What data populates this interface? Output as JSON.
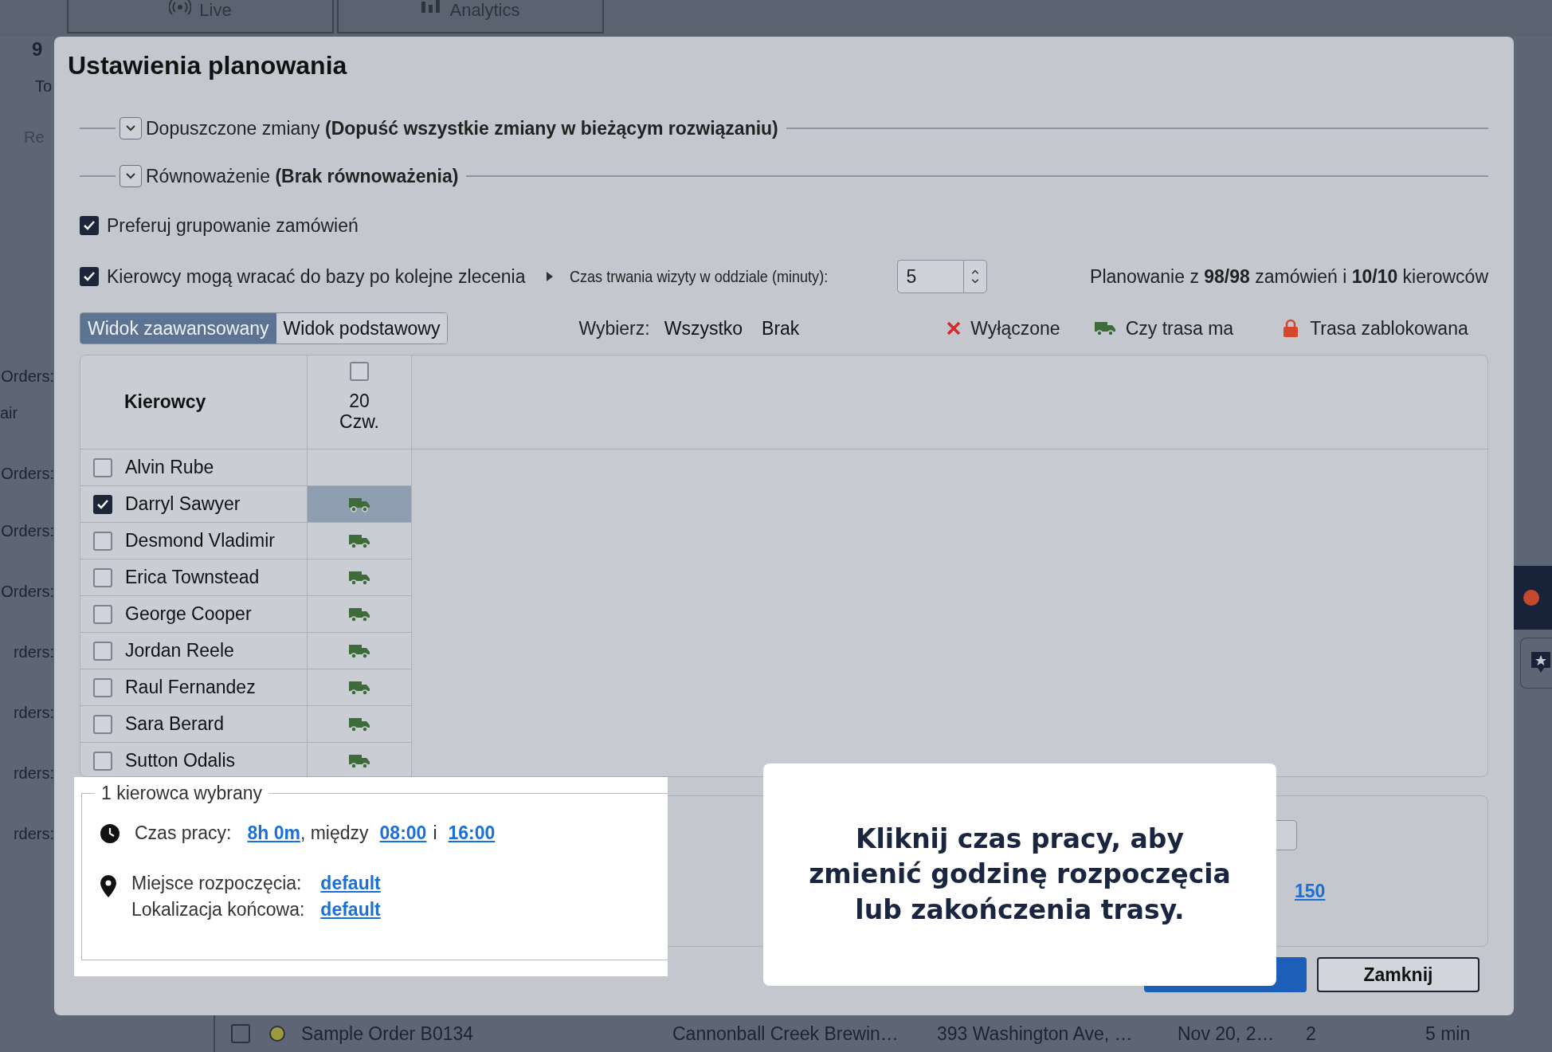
{
  "background": {
    "tabs": [
      {
        "label": "Live",
        "kind": "live"
      },
      {
        "label": "Analytics",
        "kind": "analytics"
      }
    ],
    "summary": {
      "count": "9",
      "label": "To",
      "action": "Re"
    },
    "side_labels": [
      {
        "kind": "label",
        "text": "Orders:"
      },
      {
        "kind": "note",
        "text": "air"
      },
      {
        "kind": "label",
        "text": "Orders:"
      },
      {
        "kind": "label",
        "text": "Orders:"
      },
      {
        "kind": "label",
        "text": "Orders:"
      },
      {
        "kind": "label",
        "text": "rders:"
      },
      {
        "kind": "label",
        "text": "rders:"
      },
      {
        "kind": "label",
        "text": "rders:"
      },
      {
        "kind": "label",
        "text": "rders:"
      }
    ],
    "order_row": {
      "checked": false,
      "color": "#9c9a3c",
      "name": "Sample Order B0134",
      "customer": "Cannonball Creek Brewin…",
      "address": "393 Washington Ave, …",
      "date": "Nov 20, 2…",
      "count": "2",
      "duration": "5 min"
    }
  },
  "dialog": {
    "title": "Ustawienia planowania",
    "sections": [
      {
        "text": "Dopuszczone zmiany **(Dopuść wszystkie zmiany w bieżącym rozwiązaniu)**",
        "expanded": false
      },
      {
        "text": "Równoważenie **(Brak równoważenia)**",
        "expanded": false
      }
    ],
    "options": [
      {
        "label": "Preferuj grupowanie zamówień",
        "checked": true
      },
      {
        "label": "Kierowcy mogą wracać do bazy po kolejne zlecenia",
        "checked": true
      }
    ],
    "visit_time": {
      "label": "Czas trwania wizyty w oddziale (minuty):",
      "value": "5"
    },
    "planning_summary": "Planowanie z **98/98** zamówień i **10/10** kierowców",
    "view_tabs": [
      {
        "label": "Widok zaawansowany",
        "selected": true
      },
      {
        "label": "Widok podstawowy",
        "selected": false
      }
    ],
    "select": {
      "label": "Wybierz:",
      "options": [
        "Wszystko",
        "Brak"
      ]
    },
    "legend": [
      {
        "kind": "excluded",
        "label": "Wyłączone"
      },
      {
        "kind": "route",
        "label": "Czy trasa ma"
      },
      {
        "kind": "locked",
        "label": "Trasa zablokowana"
      }
    ],
    "table": {
      "header": "Kierowcy",
      "day": {
        "checked": false,
        "date": "20",
        "weekday": "Czw."
      },
      "rows": [
        {
          "name": "Alvin Rube",
          "checked": false,
          "has_route": false,
          "selected": false
        },
        {
          "name": "Darryl Sawyer",
          "checked": true,
          "has_route": true,
          "selected": true
        },
        {
          "name": "Desmond Vladimir",
          "checked": false,
          "has_route": true,
          "selected": false
        },
        {
          "name": "Erica Townstead",
          "checked": false,
          "has_route": true,
          "selected": false
        },
        {
          "name": "George Cooper",
          "checked": false,
          "has_route": true,
          "selected": false
        },
        {
          "name": "Jordan Reele",
          "checked": false,
          "has_route": true,
          "selected": false
        },
        {
          "name": "Raul Fernandez",
          "checked": false,
          "has_route": true,
          "selected": false
        },
        {
          "name": "Sara Berard",
          "checked": false,
          "has_route": true,
          "selected": false
        },
        {
          "name": "Sutton Odalis",
          "checked": false,
          "has_route": true,
          "selected": false
        }
      ]
    },
    "selected_panel": {
      "legend": "1 kierowca wybrany",
      "work_time": {
        "label": "Czas pracy:",
        "parts": [
          {
            "kind": "link",
            "text": "8h 0m"
          },
          {
            "kind": "text",
            "text": ", między"
          },
          {
            "kind": "link",
            "text": "08:00"
          },
          {
            "kind": "text",
            "text": "i"
          },
          {
            "kind": "link",
            "text": "16:00"
          }
        ]
      },
      "locations": [
        {
          "label": "Miejsce rozpoczęcia:",
          "value": "default"
        },
        {
          "label": "Lokalizacja końcowa:",
          "value": "default"
        }
      ]
    },
    "side_value": "150",
    "tooltip": "Kliknij czas pracy, aby zmienić godzinę rozpoczęcia lub zakończenia trasy.",
    "buttons": [
      {
        "kind": "primary"
      },
      {
        "kind": "secondary",
        "label": "Zamknij"
      }
    ]
  }
}
